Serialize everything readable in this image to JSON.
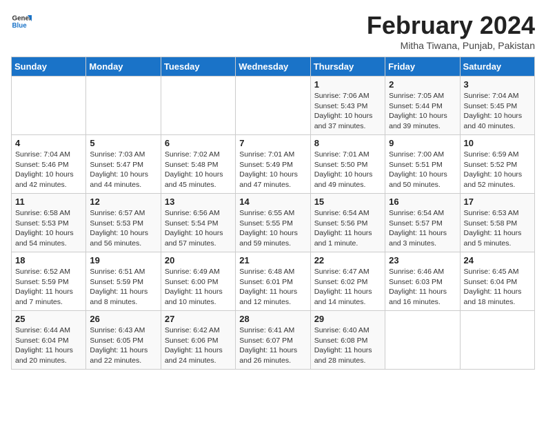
{
  "logo": {
    "line1": "General",
    "line2": "Blue"
  },
  "title": "February 2024",
  "location": "Mitha Tiwana, Punjab, Pakistan",
  "days_of_week": [
    "Sunday",
    "Monday",
    "Tuesday",
    "Wednesday",
    "Thursday",
    "Friday",
    "Saturday"
  ],
  "weeks": [
    [
      {
        "day": "",
        "info": ""
      },
      {
        "day": "",
        "info": ""
      },
      {
        "day": "",
        "info": ""
      },
      {
        "day": "",
        "info": ""
      },
      {
        "day": "1",
        "info": "Sunrise: 7:06 AM\nSunset: 5:43 PM\nDaylight: 10 hours\nand 37 minutes."
      },
      {
        "day": "2",
        "info": "Sunrise: 7:05 AM\nSunset: 5:44 PM\nDaylight: 10 hours\nand 39 minutes."
      },
      {
        "day": "3",
        "info": "Sunrise: 7:04 AM\nSunset: 5:45 PM\nDaylight: 10 hours\nand 40 minutes."
      }
    ],
    [
      {
        "day": "4",
        "info": "Sunrise: 7:04 AM\nSunset: 5:46 PM\nDaylight: 10 hours\nand 42 minutes."
      },
      {
        "day": "5",
        "info": "Sunrise: 7:03 AM\nSunset: 5:47 PM\nDaylight: 10 hours\nand 44 minutes."
      },
      {
        "day": "6",
        "info": "Sunrise: 7:02 AM\nSunset: 5:48 PM\nDaylight: 10 hours\nand 45 minutes."
      },
      {
        "day": "7",
        "info": "Sunrise: 7:01 AM\nSunset: 5:49 PM\nDaylight: 10 hours\nand 47 minutes."
      },
      {
        "day": "8",
        "info": "Sunrise: 7:01 AM\nSunset: 5:50 PM\nDaylight: 10 hours\nand 49 minutes."
      },
      {
        "day": "9",
        "info": "Sunrise: 7:00 AM\nSunset: 5:51 PM\nDaylight: 10 hours\nand 50 minutes."
      },
      {
        "day": "10",
        "info": "Sunrise: 6:59 AM\nSunset: 5:52 PM\nDaylight: 10 hours\nand 52 minutes."
      }
    ],
    [
      {
        "day": "11",
        "info": "Sunrise: 6:58 AM\nSunset: 5:53 PM\nDaylight: 10 hours\nand 54 minutes."
      },
      {
        "day": "12",
        "info": "Sunrise: 6:57 AM\nSunset: 5:53 PM\nDaylight: 10 hours\nand 56 minutes."
      },
      {
        "day": "13",
        "info": "Sunrise: 6:56 AM\nSunset: 5:54 PM\nDaylight: 10 hours\nand 57 minutes."
      },
      {
        "day": "14",
        "info": "Sunrise: 6:55 AM\nSunset: 5:55 PM\nDaylight: 10 hours\nand 59 minutes."
      },
      {
        "day": "15",
        "info": "Sunrise: 6:54 AM\nSunset: 5:56 PM\nDaylight: 11 hours\nand 1 minute."
      },
      {
        "day": "16",
        "info": "Sunrise: 6:54 AM\nSunset: 5:57 PM\nDaylight: 11 hours\nand 3 minutes."
      },
      {
        "day": "17",
        "info": "Sunrise: 6:53 AM\nSunset: 5:58 PM\nDaylight: 11 hours\nand 5 minutes."
      }
    ],
    [
      {
        "day": "18",
        "info": "Sunrise: 6:52 AM\nSunset: 5:59 PM\nDaylight: 11 hours\nand 7 minutes."
      },
      {
        "day": "19",
        "info": "Sunrise: 6:51 AM\nSunset: 5:59 PM\nDaylight: 11 hours\nand 8 minutes."
      },
      {
        "day": "20",
        "info": "Sunrise: 6:49 AM\nSunset: 6:00 PM\nDaylight: 11 hours\nand 10 minutes."
      },
      {
        "day": "21",
        "info": "Sunrise: 6:48 AM\nSunset: 6:01 PM\nDaylight: 11 hours\nand 12 minutes."
      },
      {
        "day": "22",
        "info": "Sunrise: 6:47 AM\nSunset: 6:02 PM\nDaylight: 11 hours\nand 14 minutes."
      },
      {
        "day": "23",
        "info": "Sunrise: 6:46 AM\nSunset: 6:03 PM\nDaylight: 11 hours\nand 16 minutes."
      },
      {
        "day": "24",
        "info": "Sunrise: 6:45 AM\nSunset: 6:04 PM\nDaylight: 11 hours\nand 18 minutes."
      }
    ],
    [
      {
        "day": "25",
        "info": "Sunrise: 6:44 AM\nSunset: 6:04 PM\nDaylight: 11 hours\nand 20 minutes."
      },
      {
        "day": "26",
        "info": "Sunrise: 6:43 AM\nSunset: 6:05 PM\nDaylight: 11 hours\nand 22 minutes."
      },
      {
        "day": "27",
        "info": "Sunrise: 6:42 AM\nSunset: 6:06 PM\nDaylight: 11 hours\nand 24 minutes."
      },
      {
        "day": "28",
        "info": "Sunrise: 6:41 AM\nSunset: 6:07 PM\nDaylight: 11 hours\nand 26 minutes."
      },
      {
        "day": "29",
        "info": "Sunrise: 6:40 AM\nSunset: 6:08 PM\nDaylight: 11 hours\nand 28 minutes."
      },
      {
        "day": "",
        "info": ""
      },
      {
        "day": "",
        "info": ""
      }
    ]
  ]
}
